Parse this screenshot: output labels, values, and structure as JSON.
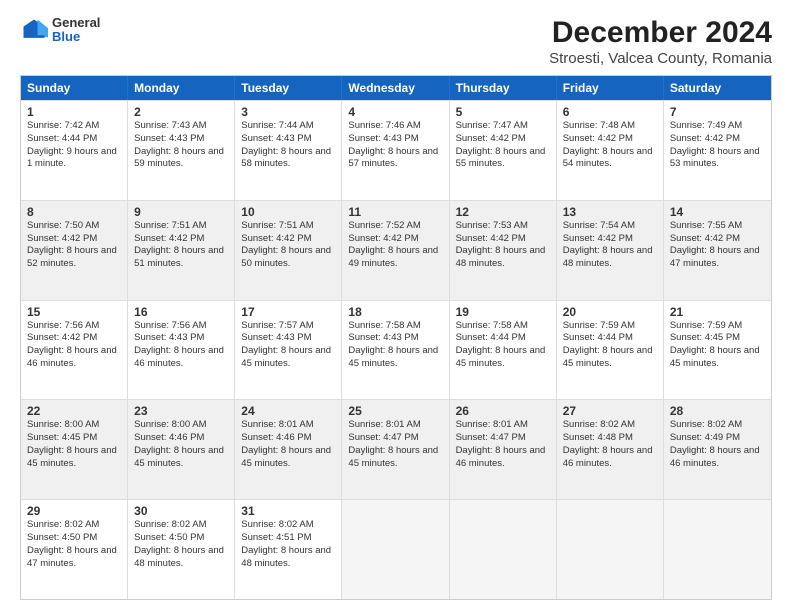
{
  "logo": {
    "general": "General",
    "blue": "Blue"
  },
  "title": "December 2024",
  "subtitle": "Stroesti, Valcea County, Romania",
  "days": [
    "Sunday",
    "Monday",
    "Tuesday",
    "Wednesday",
    "Thursday",
    "Friday",
    "Saturday"
  ],
  "rows": [
    [
      {
        "day": "1",
        "sr": "Sunrise: 7:42 AM",
        "ss": "Sunset: 4:44 PM",
        "dl": "Daylight: 9 hours and 1 minute."
      },
      {
        "day": "2",
        "sr": "Sunrise: 7:43 AM",
        "ss": "Sunset: 4:43 PM",
        "dl": "Daylight: 8 hours and 59 minutes."
      },
      {
        "day": "3",
        "sr": "Sunrise: 7:44 AM",
        "ss": "Sunset: 4:43 PM",
        "dl": "Daylight: 8 hours and 58 minutes."
      },
      {
        "day": "4",
        "sr": "Sunrise: 7:46 AM",
        "ss": "Sunset: 4:43 PM",
        "dl": "Daylight: 8 hours and 57 minutes."
      },
      {
        "day": "5",
        "sr": "Sunrise: 7:47 AM",
        "ss": "Sunset: 4:42 PM",
        "dl": "Daylight: 8 hours and 55 minutes."
      },
      {
        "day": "6",
        "sr": "Sunrise: 7:48 AM",
        "ss": "Sunset: 4:42 PM",
        "dl": "Daylight: 8 hours and 54 minutes."
      },
      {
        "day": "7",
        "sr": "Sunrise: 7:49 AM",
        "ss": "Sunset: 4:42 PM",
        "dl": "Daylight: 8 hours and 53 minutes."
      }
    ],
    [
      {
        "day": "8",
        "sr": "Sunrise: 7:50 AM",
        "ss": "Sunset: 4:42 PM",
        "dl": "Daylight: 8 hours and 52 minutes."
      },
      {
        "day": "9",
        "sr": "Sunrise: 7:51 AM",
        "ss": "Sunset: 4:42 PM",
        "dl": "Daylight: 8 hours and 51 minutes."
      },
      {
        "day": "10",
        "sr": "Sunrise: 7:51 AM",
        "ss": "Sunset: 4:42 PM",
        "dl": "Daylight: 8 hours and 50 minutes."
      },
      {
        "day": "11",
        "sr": "Sunrise: 7:52 AM",
        "ss": "Sunset: 4:42 PM",
        "dl": "Daylight: 8 hours and 49 minutes."
      },
      {
        "day": "12",
        "sr": "Sunrise: 7:53 AM",
        "ss": "Sunset: 4:42 PM",
        "dl": "Daylight: 8 hours and 48 minutes."
      },
      {
        "day": "13",
        "sr": "Sunrise: 7:54 AM",
        "ss": "Sunset: 4:42 PM",
        "dl": "Daylight: 8 hours and 48 minutes."
      },
      {
        "day": "14",
        "sr": "Sunrise: 7:55 AM",
        "ss": "Sunset: 4:42 PM",
        "dl": "Daylight: 8 hours and 47 minutes."
      }
    ],
    [
      {
        "day": "15",
        "sr": "Sunrise: 7:56 AM",
        "ss": "Sunset: 4:42 PM",
        "dl": "Daylight: 8 hours and 46 minutes."
      },
      {
        "day": "16",
        "sr": "Sunrise: 7:56 AM",
        "ss": "Sunset: 4:43 PM",
        "dl": "Daylight: 8 hours and 46 minutes."
      },
      {
        "day": "17",
        "sr": "Sunrise: 7:57 AM",
        "ss": "Sunset: 4:43 PM",
        "dl": "Daylight: 8 hours and 45 minutes."
      },
      {
        "day": "18",
        "sr": "Sunrise: 7:58 AM",
        "ss": "Sunset: 4:43 PM",
        "dl": "Daylight: 8 hours and 45 minutes."
      },
      {
        "day": "19",
        "sr": "Sunrise: 7:58 AM",
        "ss": "Sunset: 4:44 PM",
        "dl": "Daylight: 8 hours and 45 minutes."
      },
      {
        "day": "20",
        "sr": "Sunrise: 7:59 AM",
        "ss": "Sunset: 4:44 PM",
        "dl": "Daylight: 8 hours and 45 minutes."
      },
      {
        "day": "21",
        "sr": "Sunrise: 7:59 AM",
        "ss": "Sunset: 4:45 PM",
        "dl": "Daylight: 8 hours and 45 minutes."
      }
    ],
    [
      {
        "day": "22",
        "sr": "Sunrise: 8:00 AM",
        "ss": "Sunset: 4:45 PM",
        "dl": "Daylight: 8 hours and 45 minutes."
      },
      {
        "day": "23",
        "sr": "Sunrise: 8:00 AM",
        "ss": "Sunset: 4:46 PM",
        "dl": "Daylight: 8 hours and 45 minutes."
      },
      {
        "day": "24",
        "sr": "Sunrise: 8:01 AM",
        "ss": "Sunset: 4:46 PM",
        "dl": "Daylight: 8 hours and 45 minutes."
      },
      {
        "day": "25",
        "sr": "Sunrise: 8:01 AM",
        "ss": "Sunset: 4:47 PM",
        "dl": "Daylight: 8 hours and 45 minutes."
      },
      {
        "day": "26",
        "sr": "Sunrise: 8:01 AM",
        "ss": "Sunset: 4:47 PM",
        "dl": "Daylight: 8 hours and 46 minutes."
      },
      {
        "day": "27",
        "sr": "Sunrise: 8:02 AM",
        "ss": "Sunset: 4:48 PM",
        "dl": "Daylight: 8 hours and 46 minutes."
      },
      {
        "day": "28",
        "sr": "Sunrise: 8:02 AM",
        "ss": "Sunset: 4:49 PM",
        "dl": "Daylight: 8 hours and 46 minutes."
      }
    ],
    [
      {
        "day": "29",
        "sr": "Sunrise: 8:02 AM",
        "ss": "Sunset: 4:50 PM",
        "dl": "Daylight: 8 hours and 47 minutes."
      },
      {
        "day": "30",
        "sr": "Sunrise: 8:02 AM",
        "ss": "Sunset: 4:50 PM",
        "dl": "Daylight: 8 hours and 48 minutes."
      },
      {
        "day": "31",
        "sr": "Sunrise: 8:02 AM",
        "ss": "Sunset: 4:51 PM",
        "dl": "Daylight: 8 hours and 48 minutes."
      },
      null,
      null,
      null,
      null
    ]
  ]
}
